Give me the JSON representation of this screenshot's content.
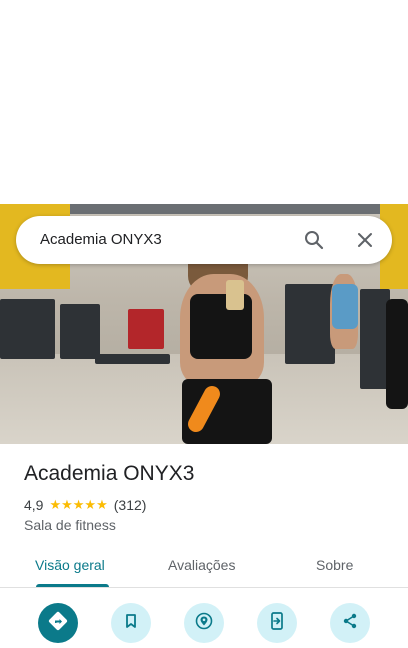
{
  "search": {
    "query": "Academia ONYX3",
    "search_icon": "search-icon",
    "close_icon": "close-icon"
  },
  "photo": {
    "subject": "gym-photo"
  },
  "place": {
    "name": "Academia ONYX3",
    "rating": "4,9",
    "stars": "★★★★★",
    "review_count": "(312)",
    "category": "Sala de fitness"
  },
  "tabs": [
    {
      "label": "Visão geral",
      "active": true
    },
    {
      "label": "Avaliações",
      "active": false
    },
    {
      "label": "Sobre",
      "active": false
    }
  ],
  "actions": [
    {
      "icon": "directions-icon"
    },
    {
      "icon": "bookmark-icon"
    },
    {
      "icon": "nearby-icon"
    },
    {
      "icon": "send-to-phone-icon"
    },
    {
      "icon": "share-icon"
    }
  ],
  "colors": {
    "accent": "#0b7a8a",
    "action_bg": "#d2f1f7",
    "star": "#fbbc04"
  }
}
